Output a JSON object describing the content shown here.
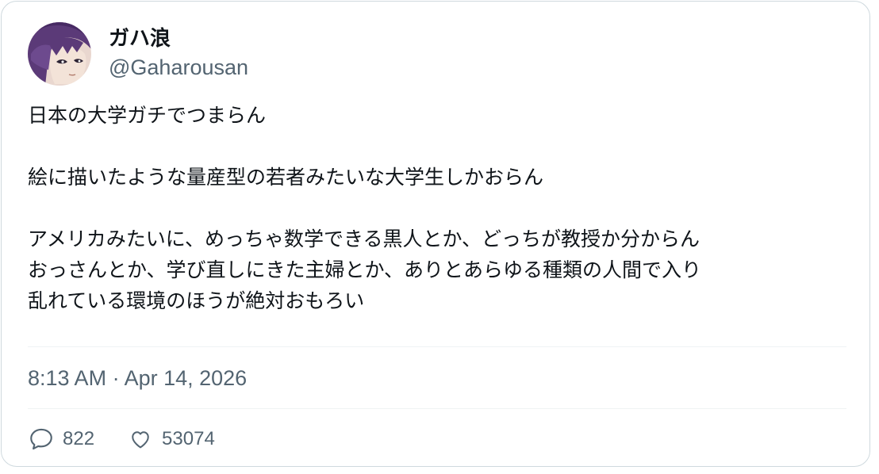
{
  "user": {
    "display_name": "ガハ浪",
    "handle": "@Gaharousan"
  },
  "tweet": {
    "paragraphs": [
      [
        "日本の大学ガチでつまらん"
      ],
      [
        "絵に描いたような量産型の若者みたいな大学生しかおらん"
      ],
      [
        "アメリカみたいに、めっちゃ数学できる黒人とか、どっちが教授か分からん",
        "おっさんとか、学び直しにきた主婦とか、ありとあらゆる種類の人間で入り",
        "乱れている環境のほうが絶対おもろい"
      ]
    ],
    "timestamp": "8:13 AM · Apr 14, 2026"
  },
  "actions": {
    "reply_icon": "speech-bubble-icon",
    "reply_count": "822",
    "like_icon": "heart-icon",
    "like_count": "53074"
  },
  "colors": {
    "text_primary": "#0f1419",
    "text_secondary": "#536471",
    "border": "#cfd9de",
    "divider": "#eff3f4"
  }
}
